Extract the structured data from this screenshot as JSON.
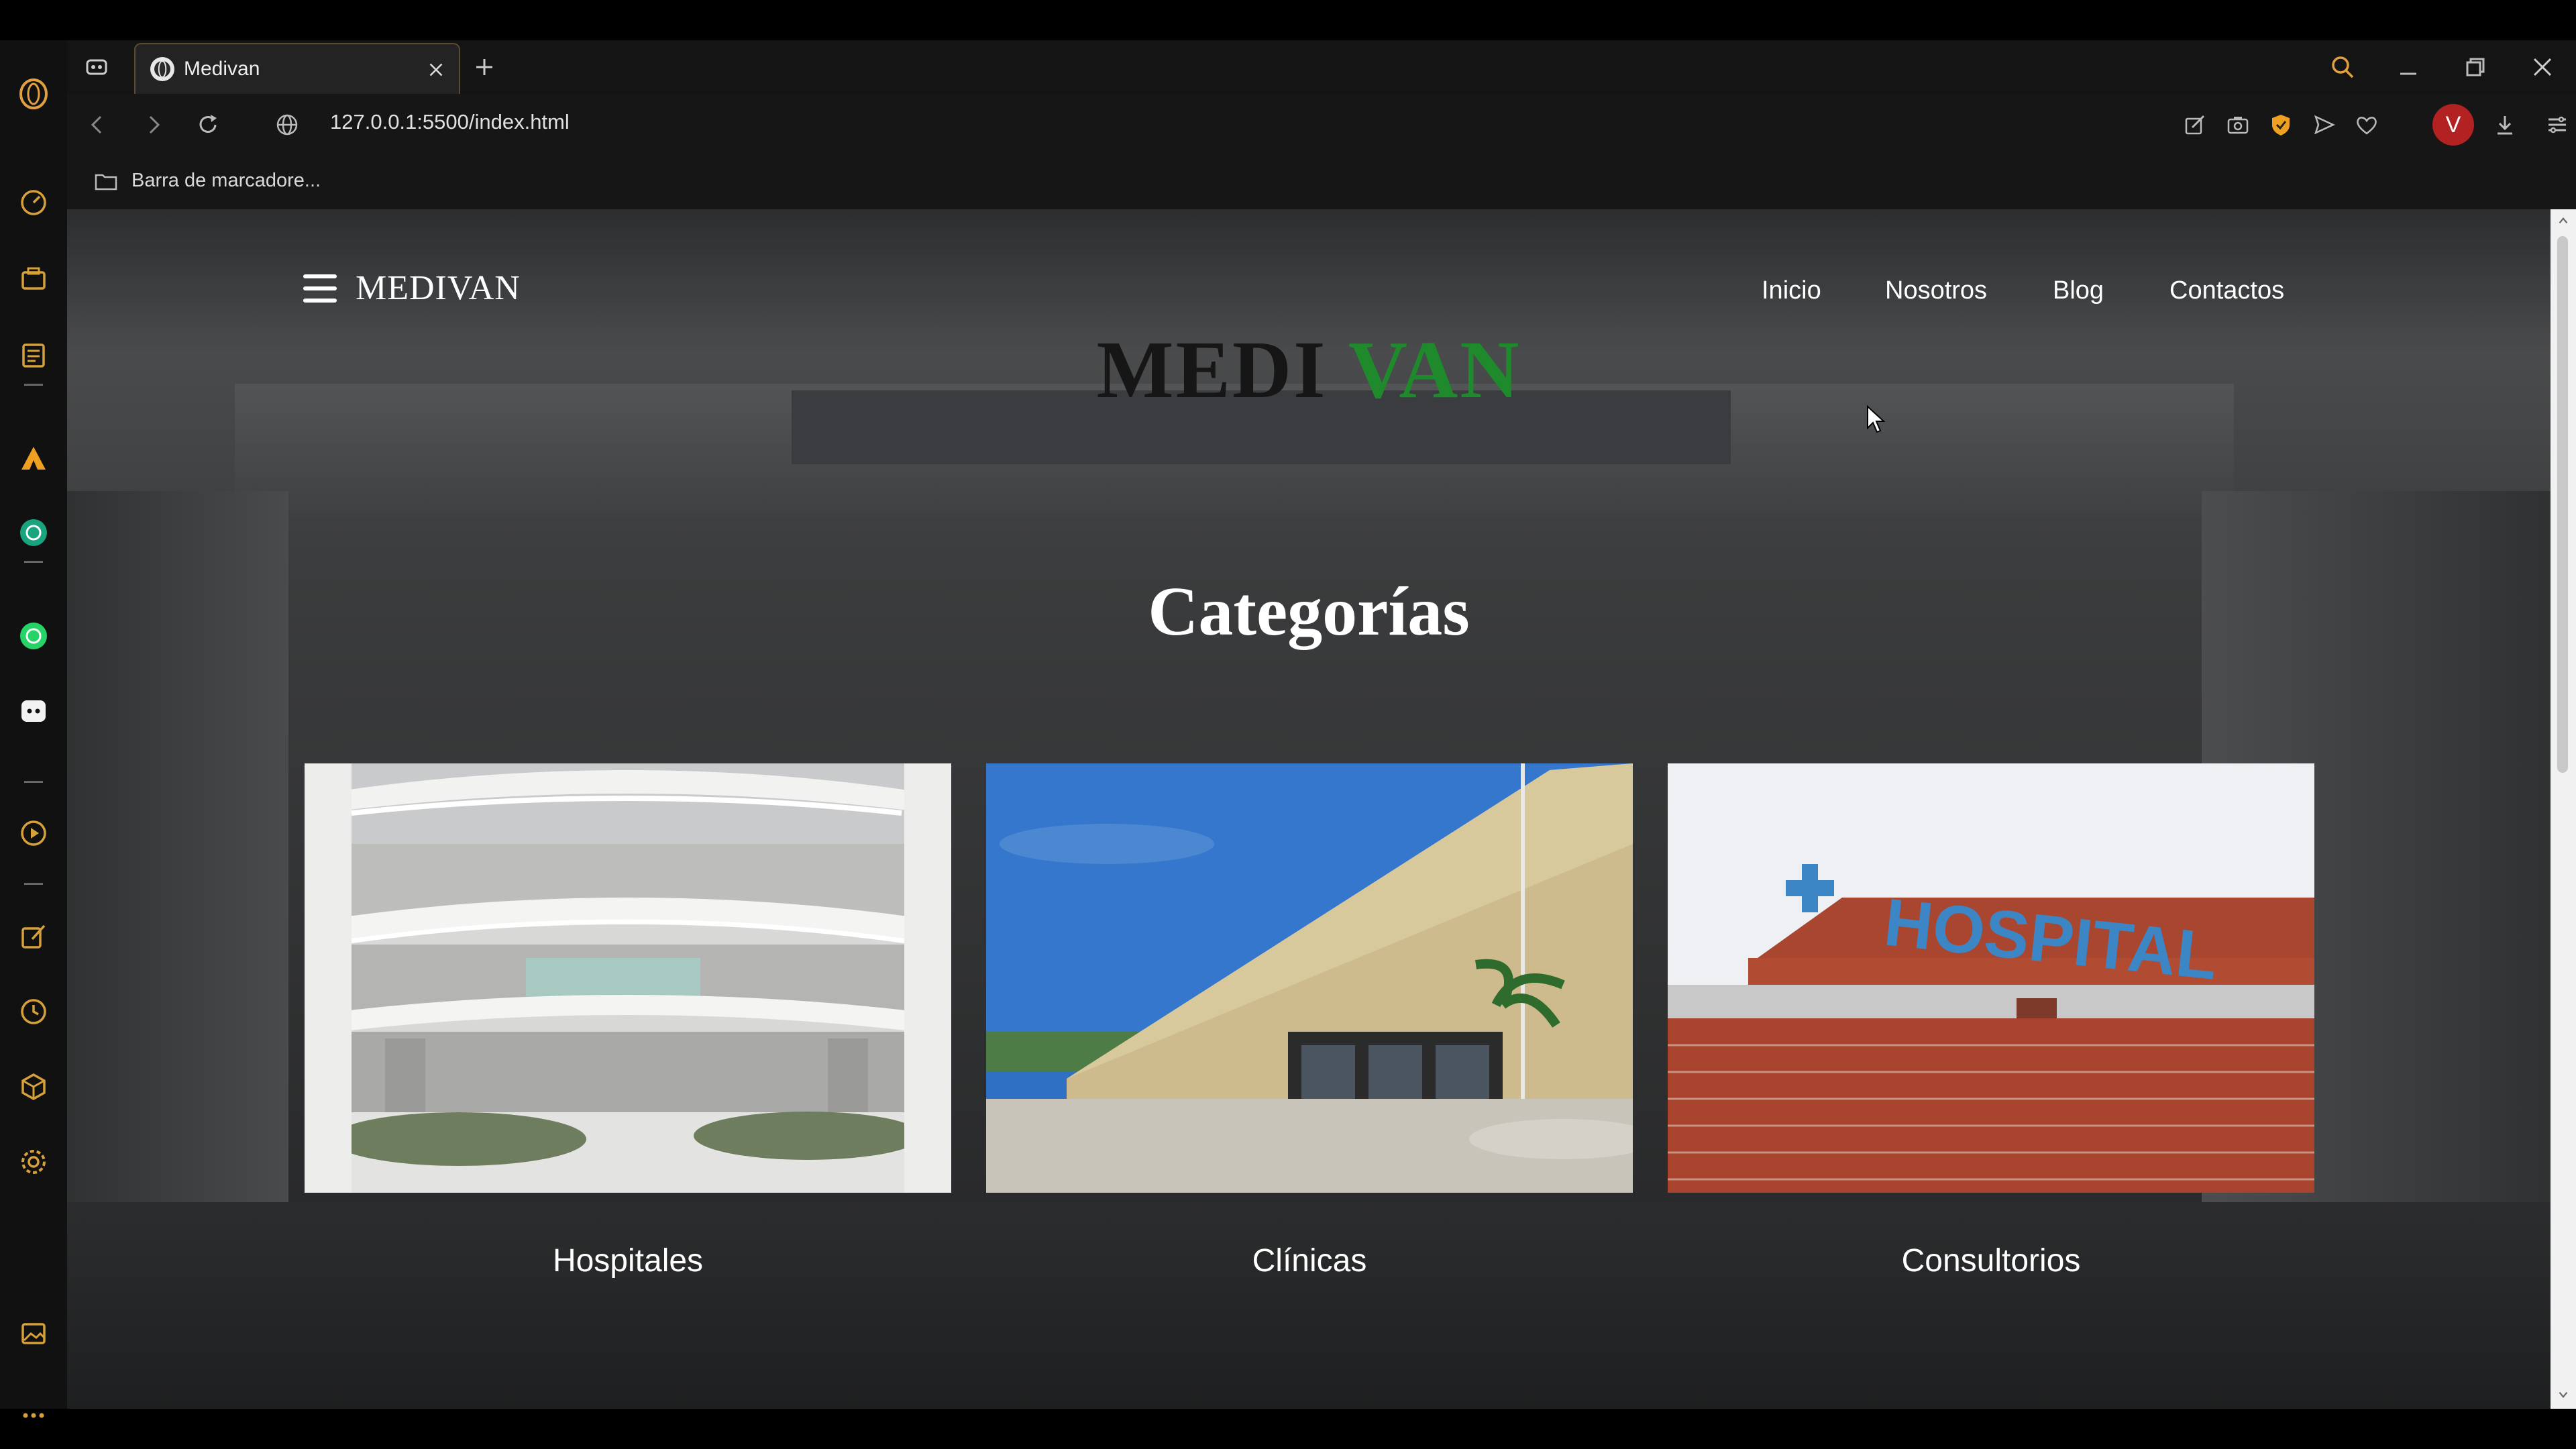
{
  "browser": {
    "tab_title": "Medivan",
    "url": "127.0.0.1:5500/index.html",
    "bookmarks_bar_label": "Barra de marcadore...",
    "profile_initial": "V",
    "accent_color": "#b32222"
  },
  "sidebar": {
    "icons": [
      "opera-logo-icon",
      "speed-dial-icon",
      "workspaces-icon",
      "news-icon",
      "aria-icon",
      "chatgpt-icon",
      "whatsapp-icon",
      "discord-icon",
      "player-icon",
      "pinboard-icon",
      "history-icon",
      "extensions-icon",
      "settings-icon",
      "gallery-icon",
      "more-icon"
    ]
  },
  "page": {
    "nav": {
      "brand": "MEDIVAN",
      "links": [
        "Inicio",
        "Nosotros",
        "Blog",
        "Contactos"
      ]
    },
    "hero": {
      "part1": "MEDI",
      "part2": "VAN",
      "part1_color": "#161616",
      "part2_color": "#1f8a2b"
    },
    "section_title": "Categorías",
    "categories": [
      {
        "label": "Hospitales"
      },
      {
        "label": "Clínicas"
      },
      {
        "label": "Consultorios"
      }
    ],
    "sign_text": "HOSPITAL"
  }
}
